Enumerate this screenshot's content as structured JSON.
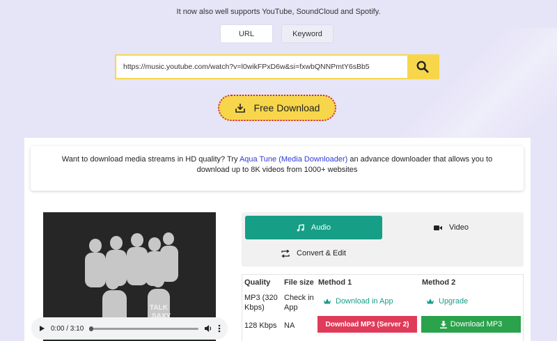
{
  "tagline": "It now also well supports YouTube, SoundCloud and Spotify.",
  "mode_tabs": [
    "URL",
    "Keyword"
  ],
  "search": {
    "value": "https://music.youtube.com/watch?v=l0wikFPxD6w&si=fxwbQNNPmtY6sBb5"
  },
  "download_button": "Free Download",
  "promo": {
    "before": "Want to download media streams in HD quality? Try ",
    "link": "Aqua Tune (Media Downloader)",
    "after": " an advance downloader that allows you to download up to 8K videos from 1000+ websites"
  },
  "player": {
    "time": "0:00 / 3:10",
    "progress": 0
  },
  "format_tabs": {
    "audio": "Audio",
    "video": "Video",
    "convert": "Convert & Edit"
  },
  "table": {
    "headers": [
      "Quality",
      "File size",
      "Method 1",
      "Method 2"
    ],
    "rows": [
      {
        "quality": "MP3 (320 Kbps)",
        "size": "Check in App",
        "method1": "Download in App",
        "method2": "Upgrade"
      },
      {
        "quality": "128 Kbps",
        "size": "NA",
        "method1": "Download MP3 (Server 2)",
        "method2": "Download MP3"
      }
    ]
  },
  "colors": {
    "accent_yellow": "#f7d64b",
    "accent_teal": "#169e86",
    "red": "#e03b59",
    "green": "#2ba24c",
    "link_blue": "#2d3bd8"
  }
}
